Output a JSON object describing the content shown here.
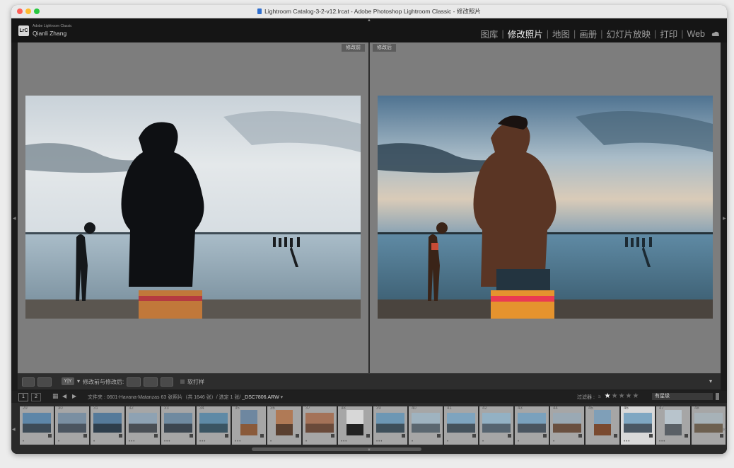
{
  "window": {
    "title": "Lightroom Catalog-3-2-v12.lrcat - Adobe Photoshop Lightroom Classic - 修改照片"
  },
  "identity": {
    "badge": "LrC",
    "app_small": "Adobe Lightroom Classic",
    "user": "Qianli Zhang"
  },
  "modules": [
    {
      "label": "图库",
      "active": false
    },
    {
      "label": "修改照片",
      "active": true
    },
    {
      "label": "地图",
      "active": false
    },
    {
      "label": "画册",
      "active": false
    },
    {
      "label": "幻灯片放映",
      "active": false
    },
    {
      "label": "打印",
      "active": false
    },
    {
      "label": "Web",
      "active": false
    }
  ],
  "compare": {
    "before_label": "修改前",
    "after_label": "修改后"
  },
  "toolbar": {
    "view_mode": "Y|Y",
    "before_after_label": "修改前与修改后:",
    "soft_proof_label": "软打样"
  },
  "film_header": {
    "page1": "1",
    "page2": "2",
    "folder_prefix": "文件夹 : ",
    "folder_name": "0601-Havana-Matanzas",
    "photo_count": "63 张照片（共 1646 张）/ 选定 1 张/",
    "filename": "_DSC7806.ARW",
    "filter_label": "过滤器 :",
    "filter_value": "有星级",
    "rating": 1
  },
  "filmstrip": [
    {
      "num": "29",
      "dots": "•",
      "portrait": false,
      "sky": "#5d86a8",
      "ground": "#3d4b57"
    },
    {
      "num": "30",
      "dots": "•",
      "portrait": false,
      "sky": "#7a8fa2",
      "ground": "#4b5560"
    },
    {
      "num": "31",
      "dots": "•",
      "portrait": false,
      "sky": "#557a9a",
      "ground": "#2e3e4c"
    },
    {
      "num": "32",
      "dots": "•••",
      "portrait": false,
      "sky": "#8ea2b3",
      "ground": "#4a4f55"
    },
    {
      "num": "33",
      "dots": "•••",
      "portrait": false,
      "sky": "#6f8aa0",
      "ground": "#3c4650"
    },
    {
      "num": "34",
      "dots": "•••",
      "portrait": false,
      "sky": "#5f8aa6",
      "ground": "#3b5563"
    },
    {
      "num": "35",
      "dots": "•••",
      "portrait": true,
      "sky": "#6e87a0",
      "ground": "#8a5a3a"
    },
    {
      "num": "36",
      "dots": "•",
      "portrait": true,
      "sky": "#b07a56",
      "ground": "#5a4030"
    },
    {
      "num": "37",
      "dots": "•",
      "portrait": false,
      "sky": "#a47258",
      "ground": "#6a4a3a"
    },
    {
      "num": "38",
      "dots": "•••",
      "portrait": true,
      "sky": "#d7d7d7",
      "ground": "#222222"
    },
    {
      "num": "39",
      "dots": "•••",
      "portrait": false,
      "sky": "#6d97b4",
      "ground": "#3e4f5a"
    },
    {
      "num": "40",
      "dots": "•",
      "portrait": false,
      "sky": "#9fb3c0",
      "ground": "#5b6770"
    },
    {
      "num": "41",
      "dots": "•",
      "portrait": false,
      "sky": "#7ea4bf",
      "ground": "#45525c"
    },
    {
      "num": "42",
      "dots": "•",
      "portrait": false,
      "sky": "#93b1c4",
      "ground": "#566470"
    },
    {
      "num": "43",
      "dots": "•",
      "portrait": false,
      "sky": "#7aa1bd",
      "ground": "#4a5560"
    },
    {
      "num": "44",
      "dots": "•",
      "portrait": false,
      "sky": "#9aa9b4",
      "ground": "#6a5040"
    },
    {
      "num": "45",
      "dots": "",
      "portrait": true,
      "sky": "#7f9fb8",
      "ground": "#7a4a30"
    },
    {
      "num": "46",
      "dots": "•••",
      "portrait": false,
      "sky": "#7fa7c2",
      "ground": "#4b5864",
      "selected": true
    },
    {
      "num": "47",
      "dots": "•••",
      "portrait": true,
      "sky": "#b8c4cc",
      "ground": "#5a6066"
    },
    {
      "num": "48",
      "dots": "",
      "portrait": false,
      "sky": "#a7b2b8",
      "ground": "#6d6050"
    }
  ],
  "colors": {
    "panel_bg": "#7d7d7d",
    "chrome_dark": "#151515",
    "active_module": "#efefef"
  }
}
